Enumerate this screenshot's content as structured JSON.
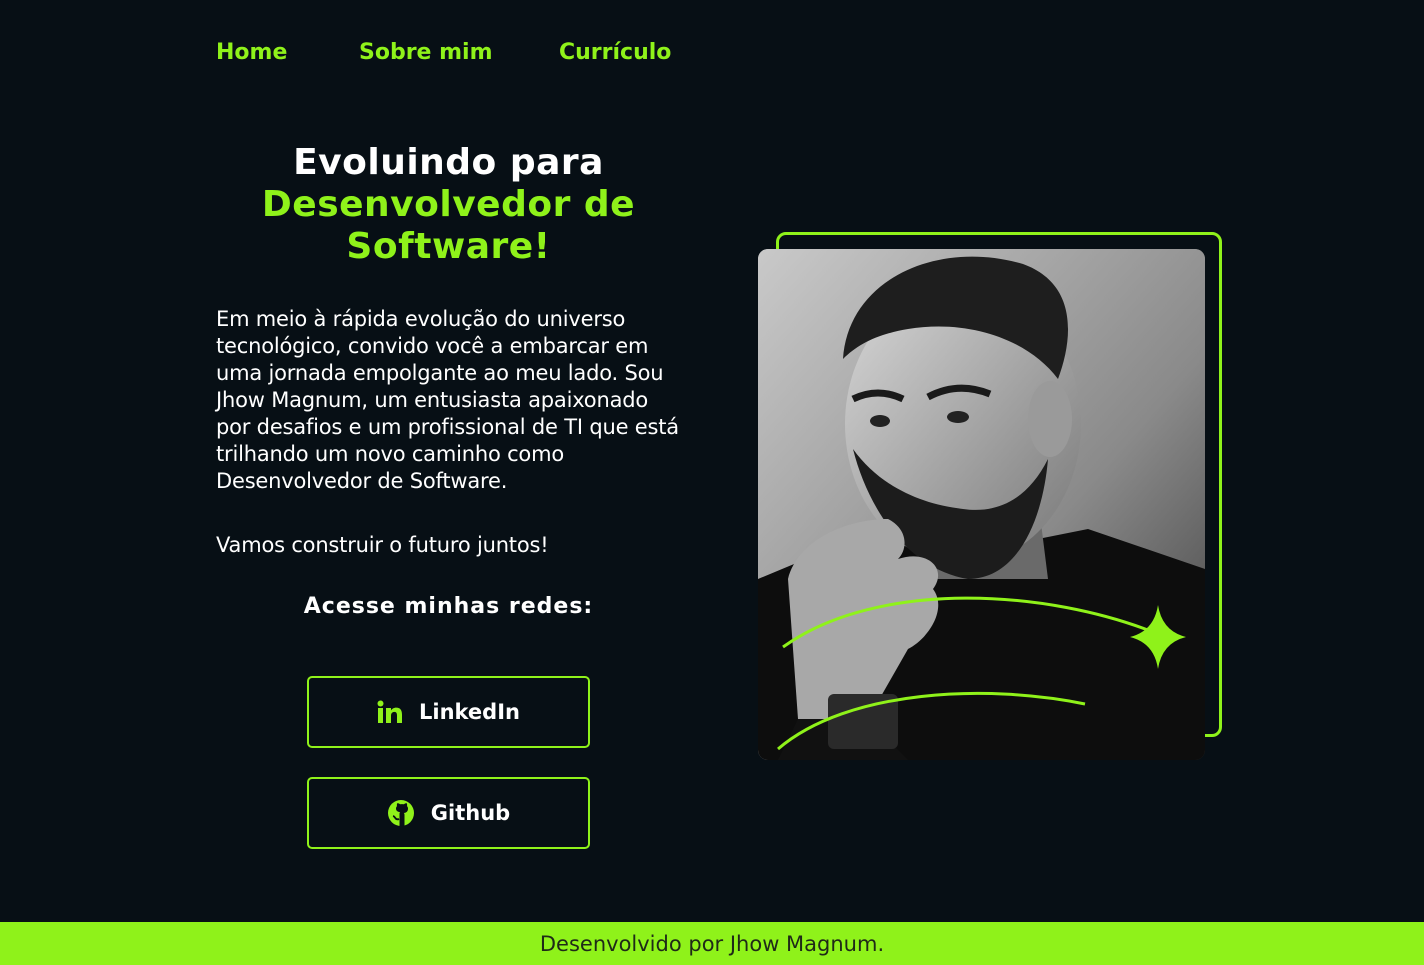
{
  "nav": {
    "items": [
      "Home",
      "Sobre mim",
      "Currículo"
    ]
  },
  "hero": {
    "headline_white": "Evoluindo para",
    "headline_green_1": "Desenvolvedor de",
    "headline_green_2": "Software!",
    "intro": "Em meio à rápida evolução do universo tecnológico, convido você a embarcar em uma jornada empolgante ao meu lado. Sou Jhow Magnum, um entusiasta apaixonado por desafios e um profissional de TI que está trilhando um novo caminho como Desenvolvedor de Software.",
    "together": "Vamos construir o futuro juntos!",
    "networks_title": "Acesse minhas redes:"
  },
  "buttons": {
    "linkedin": {
      "label": "LinkedIn",
      "icon": "linkedin-icon"
    },
    "github": {
      "label": "Github",
      "icon": "github-icon"
    }
  },
  "footer": {
    "text": "Desenvolvido por Jhow Magnum."
  },
  "colors": {
    "accent": "#8ff21a",
    "background": "#070f15",
    "text": "#ffffff"
  }
}
